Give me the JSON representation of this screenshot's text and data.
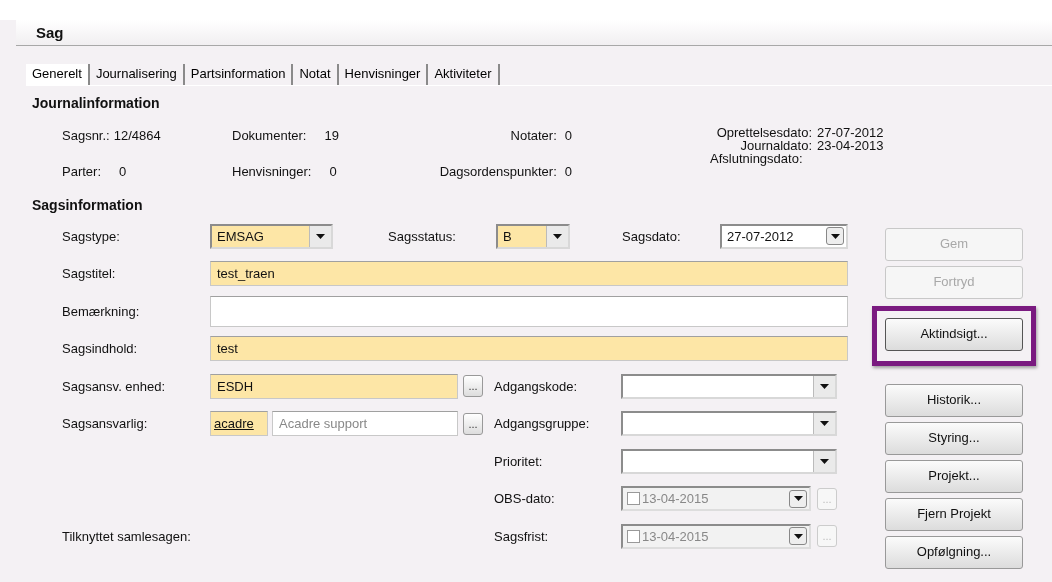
{
  "header": {
    "title": "Sag"
  },
  "tabs": [
    {
      "label": "Generelt",
      "selected": true
    },
    {
      "label": "Journalisering",
      "selected": false
    },
    {
      "label": "Partsinformation",
      "selected": false
    },
    {
      "label": "Notat",
      "selected": false
    },
    {
      "label": "Henvisninger",
      "selected": false
    },
    {
      "label": "Aktiviteter",
      "selected": false
    }
  ],
  "journalinformation": {
    "heading": "Journalinformation",
    "groups": [
      {
        "kind": "left",
        "items": [
          {
            "label": "Sagsnr.:",
            "value": "12/4864"
          },
          {
            "label": "Parter:",
            "value": "0"
          }
        ]
      },
      {
        "kind": "left",
        "items": [
          {
            "label": "Dokumenter:",
            "value": "19"
          },
          {
            "label": "Henvisninger:",
            "value": "0"
          }
        ]
      },
      {
        "kind": "right",
        "items": [
          {
            "label": "Notater:",
            "value": "0"
          },
          {
            "label": "Dagsordenspunkter:",
            "value": "0"
          }
        ]
      },
      {
        "kind": "dates",
        "items": [
          {
            "label": "Oprettelsesdato:",
            "value": "27-07-2012"
          },
          {
            "label": "Journaldato:",
            "value": "23-04-2013"
          },
          {
            "label": "Afslutningsdato:"
          }
        ]
      }
    ]
  },
  "sagsinformation": {
    "heading": "Sagsinformation",
    "sagstype": {
      "label": "Sagstype:",
      "value": "EMSAG"
    },
    "sagsstatus": {
      "label": "Sagsstatus:",
      "value": "B"
    },
    "sagsdato": {
      "label": "Sagsdato:",
      "value": "27-07-2012"
    },
    "sagstitel": {
      "label": "Sagstitel:",
      "value": "test_traen"
    },
    "bemaerkning": {
      "label": "Bemærkning:"
    },
    "sagsindhold": {
      "label": "Sagsindhold:",
      "value": "test"
    },
    "enhed": {
      "label": "Sagsansv. enhed:",
      "value": "ESDH",
      "lookup": "..."
    },
    "ansvarlig": {
      "label": "Sagsansvarlig:",
      "code": "acadre",
      "name": "Acadre support",
      "lookup": "..."
    },
    "adgangskode": {
      "label": "Adgangskode:"
    },
    "adgangsgruppe": {
      "label": "Adgangsgruppe:"
    },
    "prioritet": {
      "label": "Prioritet:"
    },
    "obs_dato": {
      "label": "OBS-dato:",
      "value": "13-04-2015",
      "checked": false,
      "lookup": "...",
      "lookup_disabled": true
    },
    "tilknyttet": {
      "label": "Tilknyttet samlesagen:"
    },
    "sagsfrist": {
      "label": "Sagsfrist:",
      "value": "13-04-2015",
      "checked": false,
      "lookup": "...",
      "lookup_disabled": true
    }
  },
  "buttons": [
    {
      "label": "Gem",
      "disabled": true,
      "highlighted": false
    },
    {
      "label": "Fortryd",
      "disabled": true,
      "highlighted": false
    },
    {
      "label": "Aktindsigt...",
      "disabled": false,
      "highlighted": true
    },
    {
      "label": "Historik...",
      "disabled": false,
      "highlighted": false
    },
    {
      "label": "Styring...",
      "disabled": false,
      "highlighted": false
    },
    {
      "label": "Projekt...",
      "disabled": false,
      "highlighted": false
    },
    {
      "label": "Fjern Projekt",
      "disabled": false,
      "highlighted": false
    },
    {
      "label": "Opfølgning...",
      "disabled": false,
      "highlighted": false
    }
  ]
}
